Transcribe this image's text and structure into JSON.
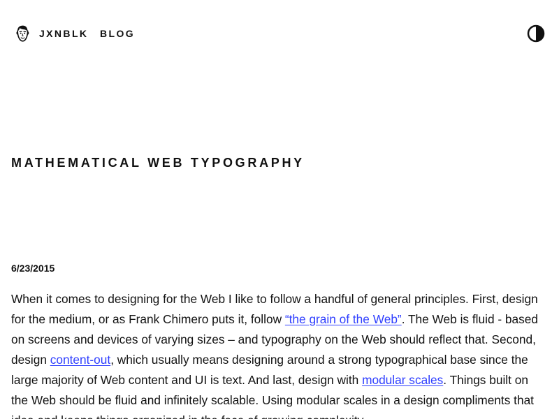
{
  "header": {
    "brand": "JXNBLK",
    "nav": {
      "blog": "BLOG"
    },
    "theme_toggle_icon": "half-contrast-icon",
    "logo_icon": "avatar-face-icon"
  },
  "post": {
    "title": "MATHEMATICAL WEB TYPOGRAPHY",
    "date": "6/23/2015",
    "paragraph": {
      "part1": "When it comes to designing for the Web I like to follow a handful of general principles. First, design for the medium, or as Frank Chimero puts it, follow ",
      "link1": "“the grain of the Web”",
      "part2": ". The Web is fluid - based on screens and devices of varying sizes – and typography on the Web should reflect that. Second, design ",
      "link2": "content-out",
      "part3": ", which usually means designing around a strong typographical base since the large majority of Web content and UI is text. And last, design with ",
      "link3": "modular scales",
      "part4": ". Things built on the Web should be fluid and infinitely scalable. Using modular scales in a design compliments that idea and keeps things organized in the face of growing complexity."
    }
  },
  "colors": {
    "background": "#ffffff",
    "text": "#111111",
    "link": "#2f3fff"
  }
}
